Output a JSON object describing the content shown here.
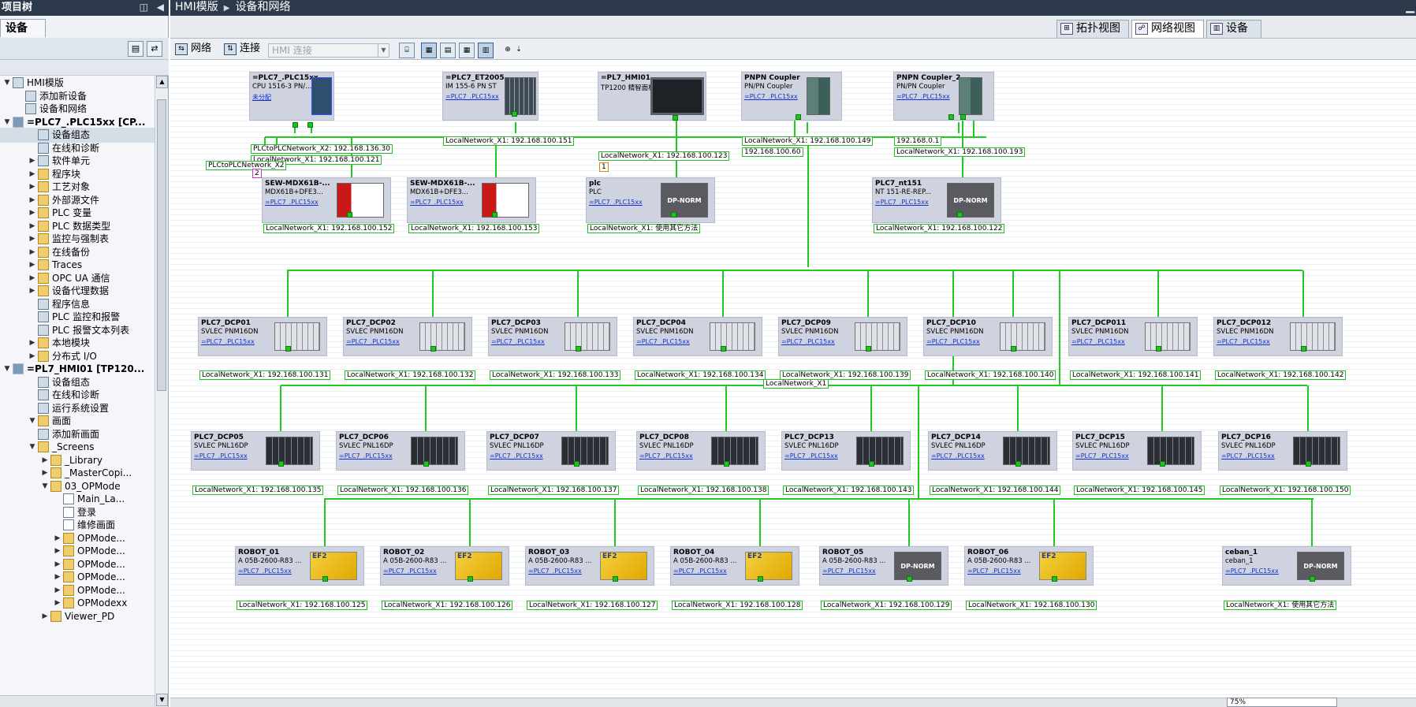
{
  "left": {
    "title": "项目树",
    "tab": "设备",
    "tree": [
      {
        "label": "HMI模版",
        "level": 0,
        "expanded": true,
        "icon": "project-icon"
      },
      {
        "label": "添加新设备",
        "level": 1,
        "icon": "add-device-icon"
      },
      {
        "label": "设备和网络",
        "level": 1,
        "icon": "network-icon"
      },
      {
        "label": "=PLC7_.PLC15xx [CP...",
        "level": 0,
        "expanded": true,
        "bold": true,
        "icon": "plc-icon"
      },
      {
        "label": "设备组态",
        "level": 2,
        "icon": "device-config-icon",
        "selected": true
      },
      {
        "label": "在线和诊断",
        "level": 2,
        "icon": "online-diag-icon"
      },
      {
        "label": "软件单元",
        "level": 2,
        "collapsed": true,
        "icon": "software-unit-icon"
      },
      {
        "label": "程序块",
        "level": 2,
        "collapsed": true,
        "icon": "folder-icon"
      },
      {
        "label": "工艺对象",
        "level": 2,
        "collapsed": true,
        "icon": "folder-icon"
      },
      {
        "label": "外部源文件",
        "level": 2,
        "collapsed": true,
        "icon": "folder-icon"
      },
      {
        "label": "PLC 变量",
        "level": 2,
        "collapsed": true,
        "icon": "folder-icon"
      },
      {
        "label": "PLC 数据类型",
        "level": 2,
        "collapsed": true,
        "icon": "folder-icon"
      },
      {
        "label": "监控与强制表",
        "level": 2,
        "collapsed": true,
        "icon": "folder-icon"
      },
      {
        "label": "在线备份",
        "level": 2,
        "collapsed": true,
        "icon": "folder-icon"
      },
      {
        "label": "Traces",
        "level": 2,
        "collapsed": true,
        "icon": "folder-icon"
      },
      {
        "label": "OPC UA 通信",
        "level": 2,
        "collapsed": true,
        "icon": "folder-icon"
      },
      {
        "label": "设备代理数据",
        "level": 2,
        "collapsed": true,
        "icon": "folder-icon"
      },
      {
        "label": "程序信息",
        "level": 2,
        "icon": "program-info-icon"
      },
      {
        "label": "PLC 监控和报警",
        "level": 2,
        "icon": "alarm-icon"
      },
      {
        "label": "PLC 报警文本列表",
        "level": 2,
        "icon": "text-list-icon"
      },
      {
        "label": "本地模块",
        "level": 2,
        "collapsed": true,
        "icon": "folder-icon"
      },
      {
        "label": "分布式 I/O",
        "level": 2,
        "collapsed": true,
        "icon": "folder-icon"
      },
      {
        "label": "=PL7_HMI01 [TP120...",
        "level": 0,
        "expanded": true,
        "bold": true,
        "icon": "hmi-icon"
      },
      {
        "label": "设备组态",
        "level": 2,
        "icon": "device-config-icon"
      },
      {
        "label": "在线和诊断",
        "level": 2,
        "icon": "online-diag-icon"
      },
      {
        "label": "运行系统设置",
        "level": 2,
        "icon": "runtime-settings-icon"
      },
      {
        "label": "画面",
        "level": 2,
        "expanded": true,
        "icon": "folder-icon"
      },
      {
        "label": "添加新画面",
        "level": 3,
        "icon": "add-screen-icon"
      },
      {
        "label": "_Screens",
        "level": 3,
        "expanded": true,
        "icon": "folder-icon"
      },
      {
        "label": "_Library",
        "level": 4,
        "collapsed": true,
        "icon": "folder-icon"
      },
      {
        "label": "_MasterCopi...",
        "level": 4,
        "collapsed": true,
        "icon": "folder-icon"
      },
      {
        "label": "03_OPMode",
        "level": 4,
        "expanded": true,
        "icon": "folder-icon"
      },
      {
        "label": "Main_La...",
        "level": 5,
        "icon": "screen-icon"
      },
      {
        "label": "登录",
        "level": 5,
        "icon": "screen-icon"
      },
      {
        "label": "维修画面",
        "level": 5,
        "icon": "screen-icon"
      },
      {
        "label": "OPMode...",
        "level": 5,
        "collapsed": true,
        "icon": "folder-icon"
      },
      {
        "label": "OPMode...",
        "level": 5,
        "collapsed": true,
        "icon": "folder-icon"
      },
      {
        "label": "OPMode...",
        "level": 5,
        "collapsed": true,
        "icon": "folder-icon"
      },
      {
        "label": "OPMode...",
        "level": 5,
        "collapsed": true,
        "icon": "folder-icon"
      },
      {
        "label": "OPMode...",
        "level": 5,
        "collapsed": true,
        "icon": "folder-icon"
      },
      {
        "label": "OPModexx",
        "level": 5,
        "collapsed": true,
        "icon": "folder-icon"
      },
      {
        "label": "Viewer_PD",
        "level": 4,
        "collapsed": true,
        "icon": "folder-icon"
      }
    ]
  },
  "right": {
    "breadcrumb": [
      "HMI模版",
      "设备和网络"
    ],
    "view_tabs": [
      "拓扑视图",
      "网络视图",
      "设备"
    ],
    "toolbar": {
      "network": "网络",
      "connect": "连接",
      "hmi_select": "HMI 连接"
    },
    "zoom": "75%"
  },
  "network": {
    "top_devices": [
      {
        "name": "=PLC7_.PLC15xx",
        "type": "CPU 1516-3 PN/...",
        "link": "未分配",
        "image": "plc"
      },
      {
        "name": "=PLC7_ET2005...",
        "type": "IM 155-6 PN ST",
        "link": "=PLC7_.PLC15xx",
        "image": "et200"
      },
      {
        "name": "=PL7_HMI01",
        "type": "TP1200 精智面板",
        "link": "",
        "image": "hmi"
      },
      {
        "name": "PNPN Coupler",
        "type": "PN/PN Coupler",
        "link": "=PLC7_.PLC15xx",
        "image": "coupler"
      },
      {
        "name": "PNPN Coupler_2",
        "type": "PN/PN Coupler",
        "link": "=PLC7_.PLC15xx",
        "image": "coupler"
      }
    ],
    "top_labels": [
      "PLCtoPLCNetwork_X2: 192.168.136.30",
      "LocalNetwork_X1: 192.168.100.121",
      "LocalNetwork_X1: 192.168.100.151",
      "LocalNetwork_X1: 192.168.100.123",
      "LocalNetwork_X1: 192.168.100.149",
      "192.168.100.60",
      "192.168.0.1",
      "LocalNetwork_X1: 192.168.100.193",
      "PLCtoPLCNetwork_X2"
    ],
    "pin_numbers": [
      "2",
      "1"
    ],
    "row2": [
      {
        "name": "SEW-MDX61B-...",
        "type": "MDX61B+DFE3...",
        "link": "=PLC7_.PLC15xx",
        "image": "sew",
        "ip": "LocalNetwork_X1: 192.168.100.152"
      },
      {
        "name": "SEW-MDX61B-...",
        "type": "MDX61B+DFE3...",
        "link": "=PLC7_.PLC15xx",
        "image": "sew",
        "ip": "LocalNetwork_X1: 192.168.100.153"
      },
      {
        "name": "plc",
        "type": "PLC",
        "link": "=PLC7_.PLC15xx",
        "image": "dpnorm",
        "ip": "LocalNetwork_X1: 使用其它方法"
      },
      {
        "name": "PLC7_nt151",
        "type": "NT 151-RE-REP...",
        "link": "=PLC7_.PLC15xx",
        "image": "dpnorm",
        "ip": "LocalNetwork_X1: 192.168.100.122"
      }
    ],
    "row3": [
      {
        "name": "PLC7_DCP01",
        "type": "SVLEC PNM16DN",
        "link": "=PLC7_.PLC15xx",
        "ip": "LocalNetwork_X1: 192.168.100.131"
      },
      {
        "name": "PLC7_DCP02",
        "type": "SVLEC PNM16DN",
        "link": "=PLC7_.PLC15xx",
        "ip": "LocalNetwork_X1: 192.168.100.132"
      },
      {
        "name": "PLC7_DCP03",
        "type": "SVLEC PNM16DN",
        "link": "=PLC7_.PLC15xx",
        "ip": "LocalNetwork_X1: 192.168.100.133"
      },
      {
        "name": "PLC7_DCP04",
        "type": "SVLEC PNM16DN",
        "link": "=PLC7_.PLC15xx",
        "ip": "LocalNetwork_X1: 192.168.100.134"
      },
      {
        "name": "PLC7_DCP09",
        "type": "SVLEC PNM16DN",
        "link": "=PLC7_.PLC15xx",
        "ip": "LocalNetwork_X1: 192.168.100.139"
      },
      {
        "name": "PLC7_DCP10",
        "type": "SVLEC PNM16DN",
        "link": "=PLC7_.PLC15xx",
        "ip": "LocalNetwork_X1: 192.168.100.140"
      },
      {
        "name": "PLC7_DCP011",
        "type": "SVLEC PNM16DN",
        "link": "=PLC7_.PLC15xx",
        "ip": "LocalNetwork_X1: 192.168.100.141"
      },
      {
        "name": "PLC7_DCP012",
        "type": "SVLEC PNM16DN",
        "link": "=PLC7_.PLC15xx",
        "ip": "LocalNetwork_X1: 192.168.100.142"
      }
    ],
    "bus_label": "LocalNetwork_X1",
    "row4": [
      {
        "name": "PLC7_DCP05",
        "type": "SVLEC PNL16DP",
        "link": "=PLC7_.PLC15xx",
        "ip": "LocalNetwork_X1: 192.168.100.135"
      },
      {
        "name": "PLC7_DCP06",
        "type": "SVLEC PNL16DP",
        "link": "=PLC7_.PLC15xx",
        "ip": "LocalNetwork_X1: 192.168.100.136"
      },
      {
        "name": "PLC7_DCP07",
        "type": "SVLEC PNL16DP",
        "link": "=PLC7_.PLC15xx",
        "ip": "LocalNetwork_X1: 192.168.100.137"
      },
      {
        "name": "PLC7_DCP08",
        "type": "SVLEC PNL16DP",
        "link": "=PLC7_.PLC15xx",
        "ip": "LocalNetwork_X1: 192.168.100.138"
      },
      {
        "name": "PLC7_DCP13",
        "type": "SVLEC PNL16DP",
        "link": "=PLC7_.PLC15xx",
        "ip": "LocalNetwork_X1: 192.168.100.143"
      },
      {
        "name": "PLC7_DCP14",
        "type": "SVLEC PNL16DP",
        "link": "=PLC7_.PLC15xx",
        "ip": "LocalNetwork_X1: 192.168.100.144"
      },
      {
        "name": "PLC7_DCP15",
        "type": "SVLEC PNL16DP",
        "link": "=PLC7_.PLC15xx",
        "ip": "LocalNetwork_X1: 192.168.100.145"
      },
      {
        "name": "PLC7_DCP16",
        "type": "SVLEC PNL16DP",
        "link": "=PLC7_.PLC15xx",
        "ip": "LocalNetwork_X1: 192.168.100.150"
      }
    ],
    "row5": [
      {
        "name": "ROBOT_01",
        "type": "A 05B-2600-R83 ...",
        "link": "=PLC7_.PLC15xx",
        "image": "robot",
        "ip": "LocalNetwork_X1: 192.168.100.125"
      },
      {
        "name": "ROBOT_02",
        "type": "A 05B-2600-R83 ...",
        "link": "=PLC7_.PLC15xx",
        "image": "robot",
        "ip": "LocalNetwork_X1: 192.168.100.126"
      },
      {
        "name": "ROBOT_03",
        "type": "A 05B-2600-R83 ...",
        "link": "=PLC7_.PLC15xx",
        "image": "robot",
        "ip": "LocalNetwork_X1: 192.168.100.127"
      },
      {
        "name": "ROBOT_04",
        "type": "A 05B-2600-R83 ...",
        "link": "=PLC7_.PLC15xx",
        "image": "robot",
        "ip": "LocalNetwork_X1: 192.168.100.128"
      },
      {
        "name": "ROBOT_05",
        "type": "A 05B-2600-R83 ...",
        "link": "=PLC7_.PLC15xx",
        "image": "dpnorm",
        "ip": "LocalNetwork_X1: 192.168.100.129"
      },
      {
        "name": "ROBOT_06",
        "type": "A 05B-2600-R83 ...",
        "link": "=PLC7_.PLC15xx",
        "image": "robot",
        "ip": "LocalNetwork_X1: 192.168.100.130"
      },
      {
        "name": "ceban_1",
        "type": "ceban_1",
        "link": "=PLC7_.PLC15xx",
        "image": "dpnorm",
        "ip": "LocalNetwork_X1: 使用其它方法"
      }
    ],
    "image_text": {
      "dpnorm": "DP-NORM",
      "robot": "EF2"
    },
    "colors": {
      "bus": "#22c922",
      "device_bg": "#cfd3e0",
      "link": "#1030d0",
      "title_bar": "#2c3a4c"
    }
  }
}
